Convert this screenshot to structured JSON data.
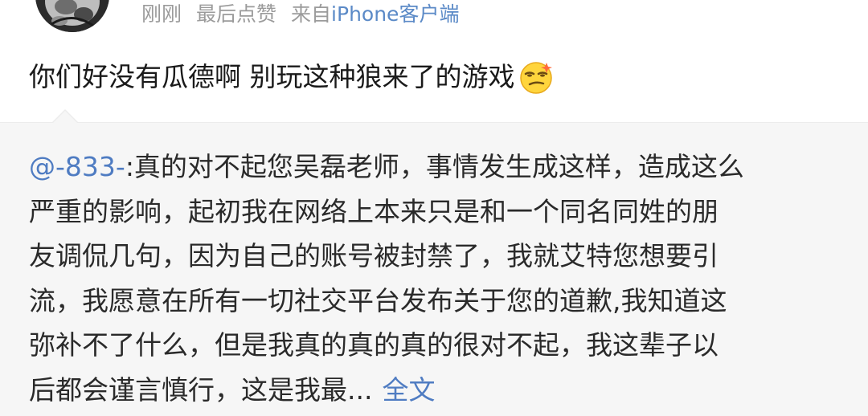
{
  "post": {
    "meta": {
      "time": "刚刚",
      "last_like": "最后点赞",
      "source_prefix": "来自",
      "source_device": "iPhone",
      "source_suffix": "客户端"
    },
    "text": "你们好没有瓜德啊 别玩这种狼来了的游戏",
    "emoji_icon": "smug-face-emoji"
  },
  "quote": {
    "mention": "@-833-",
    "line1_rest": ":真的对不起您吴磊老师，事情发生成这样，造成这么",
    "lines": [
      "严重的影响，起初我在网络上本来只是和一个同名同姓的朋",
      "友调侃几句，因为自己的账号被封禁了，我就艾特您想要引",
      "流，我愿意在所有一切社交平台发布关于您的道歉,我知道这",
      "弥补不了什么，但是我真的真的真的很对不起，我这辈子以"
    ],
    "last_line": "后都会谨言慎行，这是我最...",
    "full_text_link": "全文"
  },
  "colors": {
    "link": "#4f7cc2",
    "meta_gray": "#9b9b9b",
    "quote_bg": "#f6f6f6"
  }
}
